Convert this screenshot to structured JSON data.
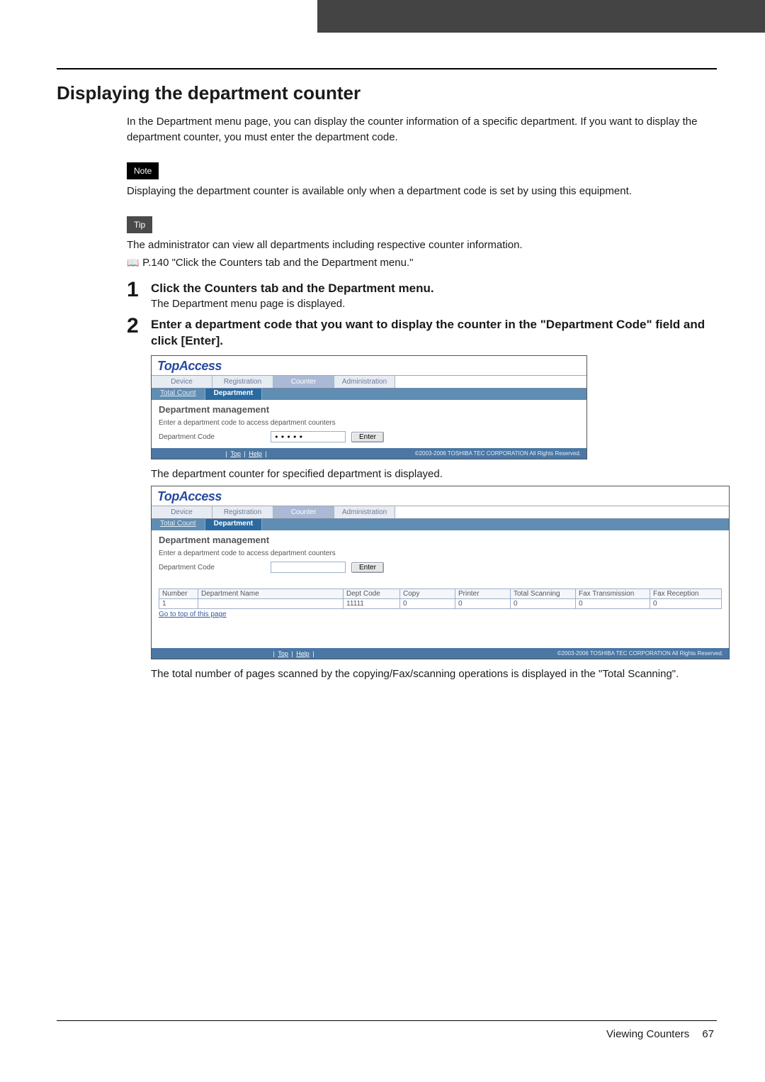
{
  "heading": "Displaying the department counter",
  "intro": "In the Department menu page, you can display the counter information of a specific department. If you want to display the department counter, you must enter the department code.",
  "note_label": "Note",
  "note_text": "Displaying the department counter is available only when a department code is set by using this equipment.",
  "tip_label": "Tip",
  "tip_text": "The administrator can view all departments including respective counter information.",
  "tip_ref": "P.140 \"Click the Counters tab and the Department menu.\"",
  "book_glyph": "📖",
  "steps": [
    {
      "num": "1",
      "title": "Click the Counters tab and the Department menu.",
      "text": "The Department menu page is displayed."
    },
    {
      "num": "2",
      "title": "Enter a department code that you want to display the counter in the \"Department Code\" field and click [Enter].",
      "text": ""
    }
  ],
  "shot_common": {
    "logo": "TopAccess",
    "tabs": [
      "Device",
      "Registration",
      "Counter",
      "Administration"
    ],
    "active_tab_index": 2,
    "sub_tabs": [
      "Total Count",
      "Department"
    ],
    "active_sub_tab_index": 1,
    "panel_title": "Department management",
    "panel_subtext": "Enter a department code to access department counters",
    "field_label": "Department Code",
    "enter_btn": "Enter",
    "footer_links": [
      "Top",
      "Help"
    ],
    "copyright": "©2003-2006 TOSHIBA TEC CORPORATION All Rights Reserved."
  },
  "shot1": {
    "code_value": "•••••"
  },
  "after_shot1": "The department counter for specified department is displayed.",
  "shot2": {
    "code_value": "",
    "table_headers": [
      "Number",
      "Department Name",
      "Dept Code",
      "Copy",
      "Printer",
      "Total Scanning",
      "Fax Transmission",
      "Fax Reception"
    ],
    "table_row": [
      "1",
      "",
      "11111",
      "0",
      "0",
      "0",
      "0",
      "0"
    ],
    "goto": "Go to top of this page"
  },
  "after_shot2": "The total number of pages scanned by the copying/Fax/scanning operations is displayed in the \"Total Scanning\".",
  "footer": {
    "section": "Viewing Counters",
    "page": "67"
  }
}
